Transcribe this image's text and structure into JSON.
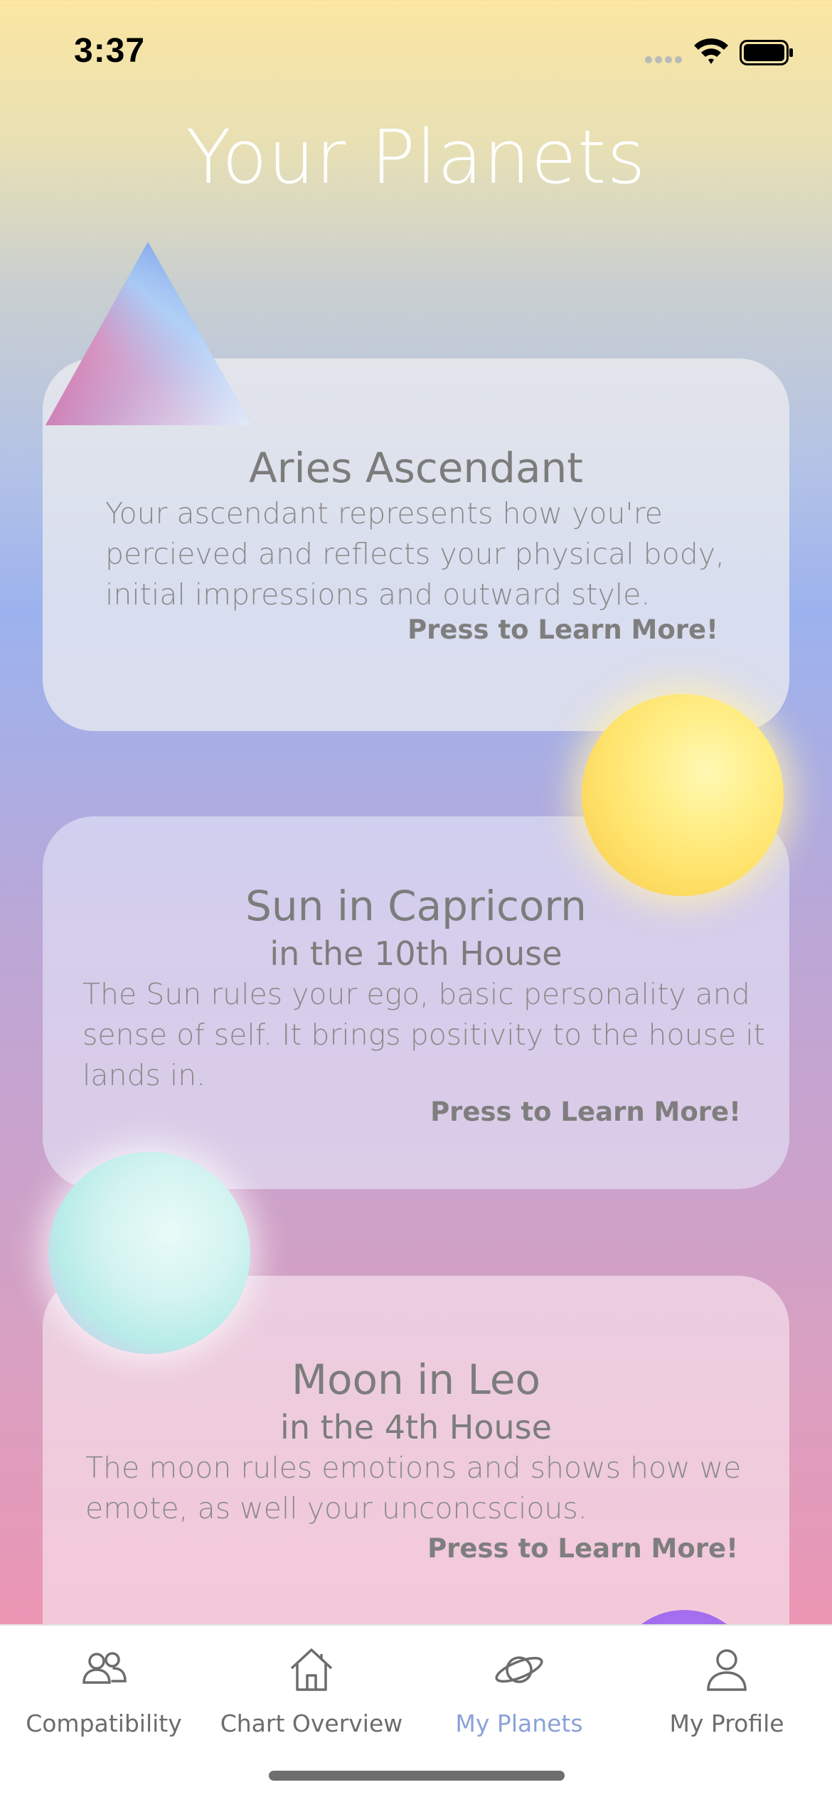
{
  "status_bar": {
    "time": "3:37",
    "icons": [
      "cellular-signal-icon",
      "wifi-icon",
      "battery-icon"
    ]
  },
  "header": {
    "title": "Your Planets"
  },
  "cards": [
    {
      "title": "Aries Ascendant",
      "subtitle": "",
      "description": "Your ascendant represents how you're percieved and reflects your physical body, initial impressions and outward style.",
      "learn_more": "Press to Learn More!",
      "graphic": "triangle-icon"
    },
    {
      "title": "Sun in Capricorn",
      "subtitle": "in the 10th House",
      "description": "The Sun rules your ego, basic personality and sense of self. It brings positivity to the house it lands in.",
      "learn_more": "Press to Learn More!",
      "graphic": "sun-orb-icon"
    },
    {
      "title": "Moon in Leo",
      "subtitle": "in the 4th House",
      "description": "The moon rules emotions and shows how we emote, as well your unconcscious.",
      "learn_more": "Press to Learn More!",
      "graphic": "moon-orb-icon"
    }
  ],
  "tab_bar": {
    "tabs": [
      {
        "label": "Compatibility",
        "icon": "people-icon",
        "active": false
      },
      {
        "label": "Chart Overview",
        "icon": "home-icon",
        "active": false
      },
      {
        "label": "My Planets",
        "icon": "planet-icon",
        "active": true
      },
      {
        "label": "My Profile",
        "icon": "person-icon",
        "active": false
      }
    ]
  },
  "colors": {
    "active_tab": "#8aa2d8",
    "inactive_tab": "#6c6c6c",
    "card_text": "#7c7c7c",
    "title_text": "#ffffff"
  }
}
